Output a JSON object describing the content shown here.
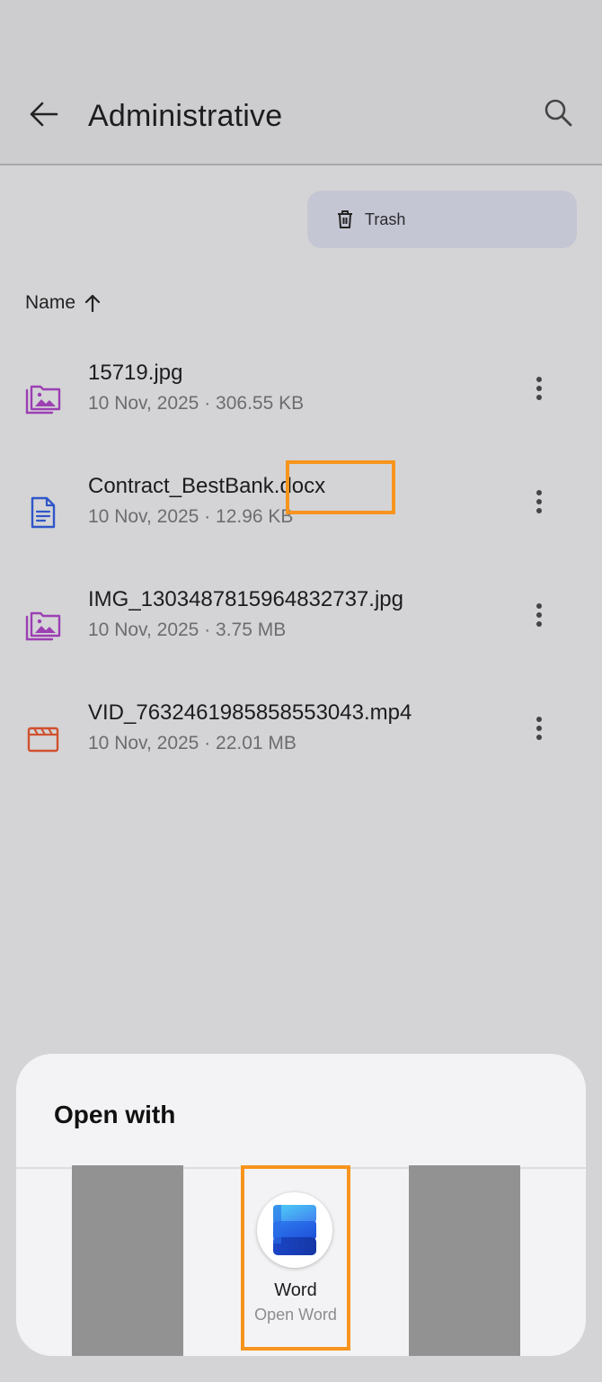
{
  "header": {
    "title": "Administrative",
    "back_icon": "arrow-left-icon",
    "search_icon": "search-icon"
  },
  "trash": {
    "label": "Trash",
    "icon": "trash-icon"
  },
  "sort": {
    "label": "Name",
    "direction_icon": "arrow-up-icon"
  },
  "files": [
    {
      "name": "15719.jpg",
      "meta": "10 Nov, 2025 · 306.55 KB",
      "icon": "image-folder-icon",
      "icon_color": "#9c3fb3"
    },
    {
      "name": "Contract_BestBank.docx",
      "meta": "10 Nov, 2025 · 12.96 KB",
      "icon": "document-icon",
      "icon_color": "#2f56c8"
    },
    {
      "name": "IMG_1303487815964832737.jpg",
      "meta": "10 Nov, 2025 · 3.75 MB",
      "icon": "image-folder-icon",
      "icon_color": "#9c3fb3"
    },
    {
      "name": "VID_7632461985858553043.mp4",
      "meta": "10 Nov, 2025 · 22.01 MB",
      "icon": "video-clapper-icon",
      "icon_color": "#d0502e"
    }
  ],
  "open_with": {
    "title": "Open with",
    "apps": [
      {
        "name": "Word",
        "subtitle": "Open Word",
        "icon": "word-app-icon"
      }
    ]
  },
  "colors": {
    "highlight": "#f7941d",
    "background": "#d4d4d6",
    "sheet": "#f3f3f5"
  }
}
